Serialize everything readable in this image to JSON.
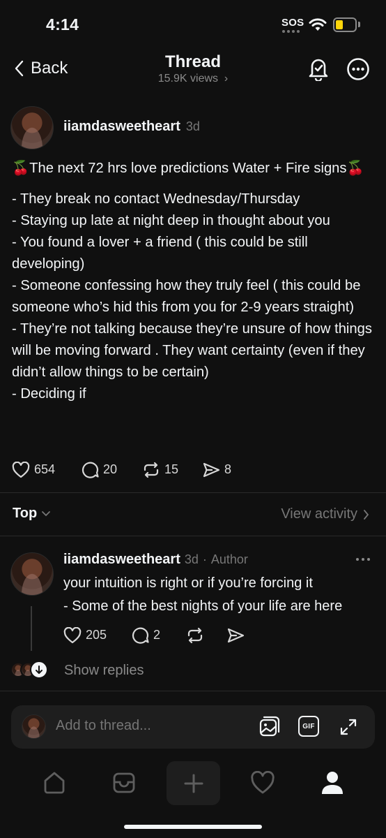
{
  "status_bar": {
    "time": "4:14",
    "sos": "SOS",
    "battery_color": "#ffd60a"
  },
  "header": {
    "back_label": "Back",
    "title": "Thread",
    "views": "15.9K views"
  },
  "post": {
    "username": "iiamdasweetheart",
    "age": "3d",
    "lines": [
      "🍒The next 72 hrs love predictions Water + Fire signs🍒",
      "",
      "- They break no contact Wednesday/Thursday",
      "- Staying up late at night deep in thought about you",
      "- You found a lover + a friend ( this could be still developing)",
      "- Someone confessing how they truly feel ( this could be someone who’s hid this from you for 2-9 years straight)",
      "- They’re not talking because they’re unsure of how things will be moving forward . They want certainty (even if they didn’t allow things to be certain)",
      "- Deciding if"
    ],
    "likes": "654",
    "comments": "20",
    "reposts": "15",
    "shares": "8"
  },
  "sort": {
    "label": "Top",
    "view_activity": "View activity"
  },
  "reply": {
    "username": "iiamdasweetheart",
    "age": "3d",
    "separator": "·",
    "badge": "Author",
    "lines": [
      "your intuition is right or if you’re forcing it",
      "- Some of the best nights of your life are here"
    ],
    "likes": "205",
    "comments": "2",
    "show_replies": "Show replies"
  },
  "composer": {
    "placeholder": "Add to thread...",
    "gif_label": "GIF"
  },
  "tabs": [
    "home-tab",
    "inbox-tab",
    "create-tab",
    "activity-tab",
    "profile-tab"
  ]
}
